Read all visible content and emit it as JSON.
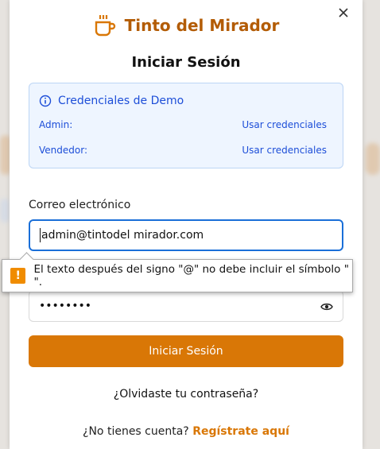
{
  "brand": {
    "name": "Tinto del Mirador",
    "accent": "#b35c06"
  },
  "login": {
    "title": "Iniciar Sesión",
    "demo": {
      "heading": "Credenciales de Demo",
      "rows": [
        {
          "role": "Admin:",
          "action": "Usar credenciales"
        },
        {
          "role": "Vendedor:",
          "action": "Usar credenciales"
        }
      ]
    },
    "email": {
      "label": "Correo electrónico",
      "value": "admin@tintodel mirador.com"
    },
    "password": {
      "masked_value": "••••••••"
    },
    "validation": {
      "message": "El texto después del signo \"@\" no debe incluir el símbolo \" \"."
    },
    "submit_label": "Iniciar Sesión",
    "forgot_label": "¿Olvidaste tu contraseña?",
    "signup": {
      "prompt": "¿No tienes cuenta?",
      "link": "Regístrate aquí"
    }
  },
  "icons": {
    "close": "close-icon",
    "brand": "coffee-cup-icon",
    "info": "info-icon",
    "warning": "warning-icon",
    "toggle": "eye-icon"
  }
}
